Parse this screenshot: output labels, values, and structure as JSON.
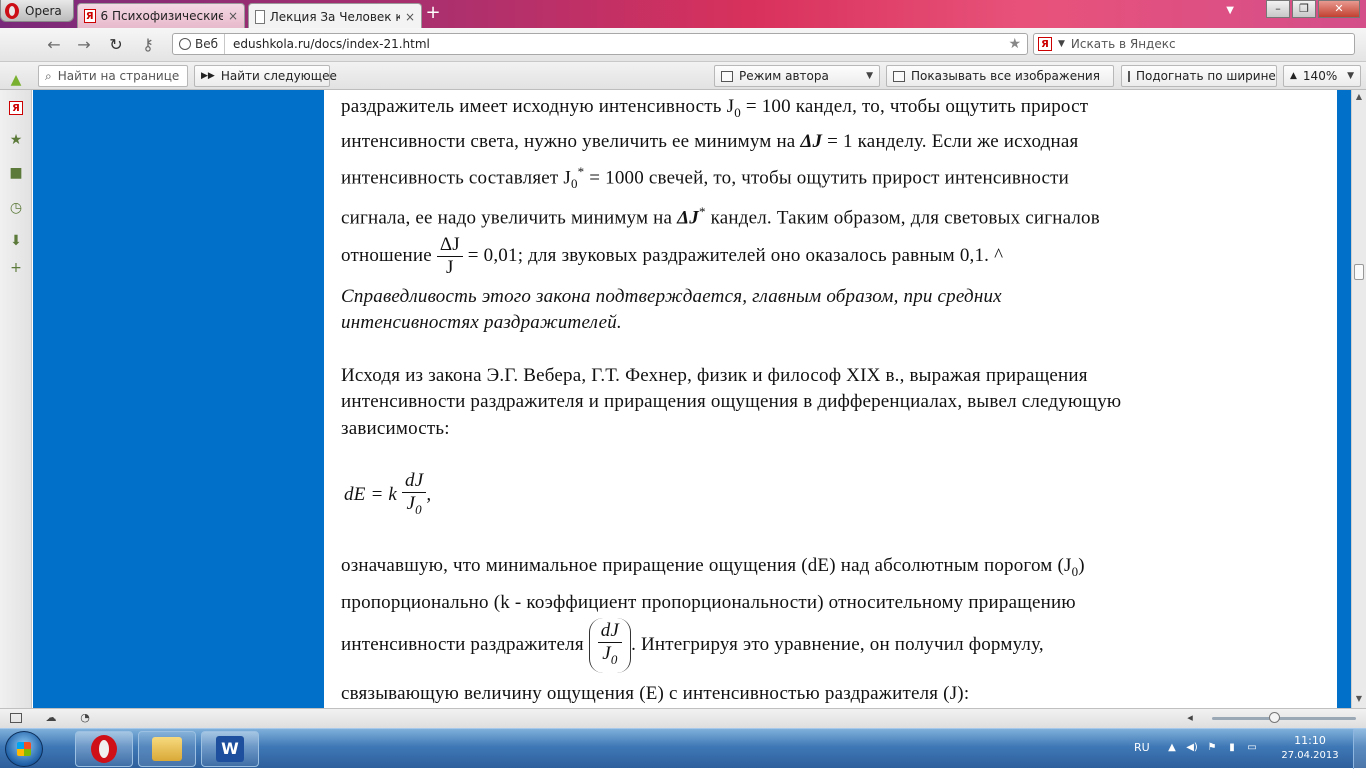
{
  "browser": {
    "menu_label": "Opera",
    "tabs": [
      {
        "label": "6 Психофизические за…",
        "active": false
      },
      {
        "label": "Лекция За Человек ка…",
        "active": true
      }
    ],
    "address": {
      "mode_label": "Веб",
      "url": "edushkola.ru/docs/index-21.html"
    },
    "search": {
      "engine_icon": "Я",
      "placeholder": "Искать в Яндекс"
    }
  },
  "toolbar": {
    "find_placeholder": "Найти на странице",
    "find_next_label": "Найти следующее",
    "author_mode_label": "Режим автора",
    "show_images_label": "Показывать все изображения",
    "fit_width_label": "Подогнать по ширине",
    "zoom_label": "140%"
  },
  "document": {
    "l1_a": "раздражитель имеет исходную интенсивность J",
    "l1_sub": "0",
    "l1_b": " = 100 кандел, то, чтобы ощутить прирост",
    "l2_a": "интенсивности света, нужно увеличить ее минимум на ",
    "delta_j": "ΔJ",
    "l2_b": " = 1 канделу. Если же исходная",
    "l3_a": "интенсивность составляет J",
    "l3_sub": "0",
    "l3_sup": "*",
    "l3_b": " = 1000 свечей, то, чтобы ощутить прирост интенсивности",
    "l4_a": "сигнала, ее надо увеличить минимум на ",
    "l4_sup": "*",
    "l4_b": " кандел. Таким образом, для световых сигналов",
    "l5_a": "отношение ",
    "frac1_num": "ΔJ",
    "frac1_den": "J",
    "frac1_eq": "= 0,01",
    "l5_b": "; для звуковых раздражителей оно оказалось равным 0,1. ^",
    "italic1": "Справедливость этого закона подтверждается, главным образом, при средних",
    "italic2": "интенсивностях раздражителей.",
    "p2_l1": "Исходя из закона Э.Г. Вебера, Г.Т. Фехнер, физик и философ XIX в., выражая приращения",
    "p2_l2": "интенсивности раздражителя и приращения ощущения в дифференциалах, вывел следующую",
    "p2_l3": "зависимость:",
    "formula_lhs": "dE = k",
    "formula_num": "dJ",
    "formula_den": "J",
    "formula_den_sub": "0",
    "formula_tail": ",",
    "p3_l1_a": "означавшую, что минимальное приращение ощущения (dE) над абсолютным порогом (J",
    "p3_l1_sub": "0",
    "p3_l1_b": ")",
    "p3_l2": "пропорционально (k - коэффициент пропорциональности) относительному приращению",
    "p3_l3_a": "интенсивности раздражителя ",
    "p3_l3_b": ". Интегрируя это уравнение, он получил формулу,",
    "p3_l4": "связывающую величину ощущения (E) с интенсивностью раздражителя (J):"
  },
  "taskbar": {
    "lang": "RU",
    "time": "11:10",
    "date": "27.04.2013"
  }
}
